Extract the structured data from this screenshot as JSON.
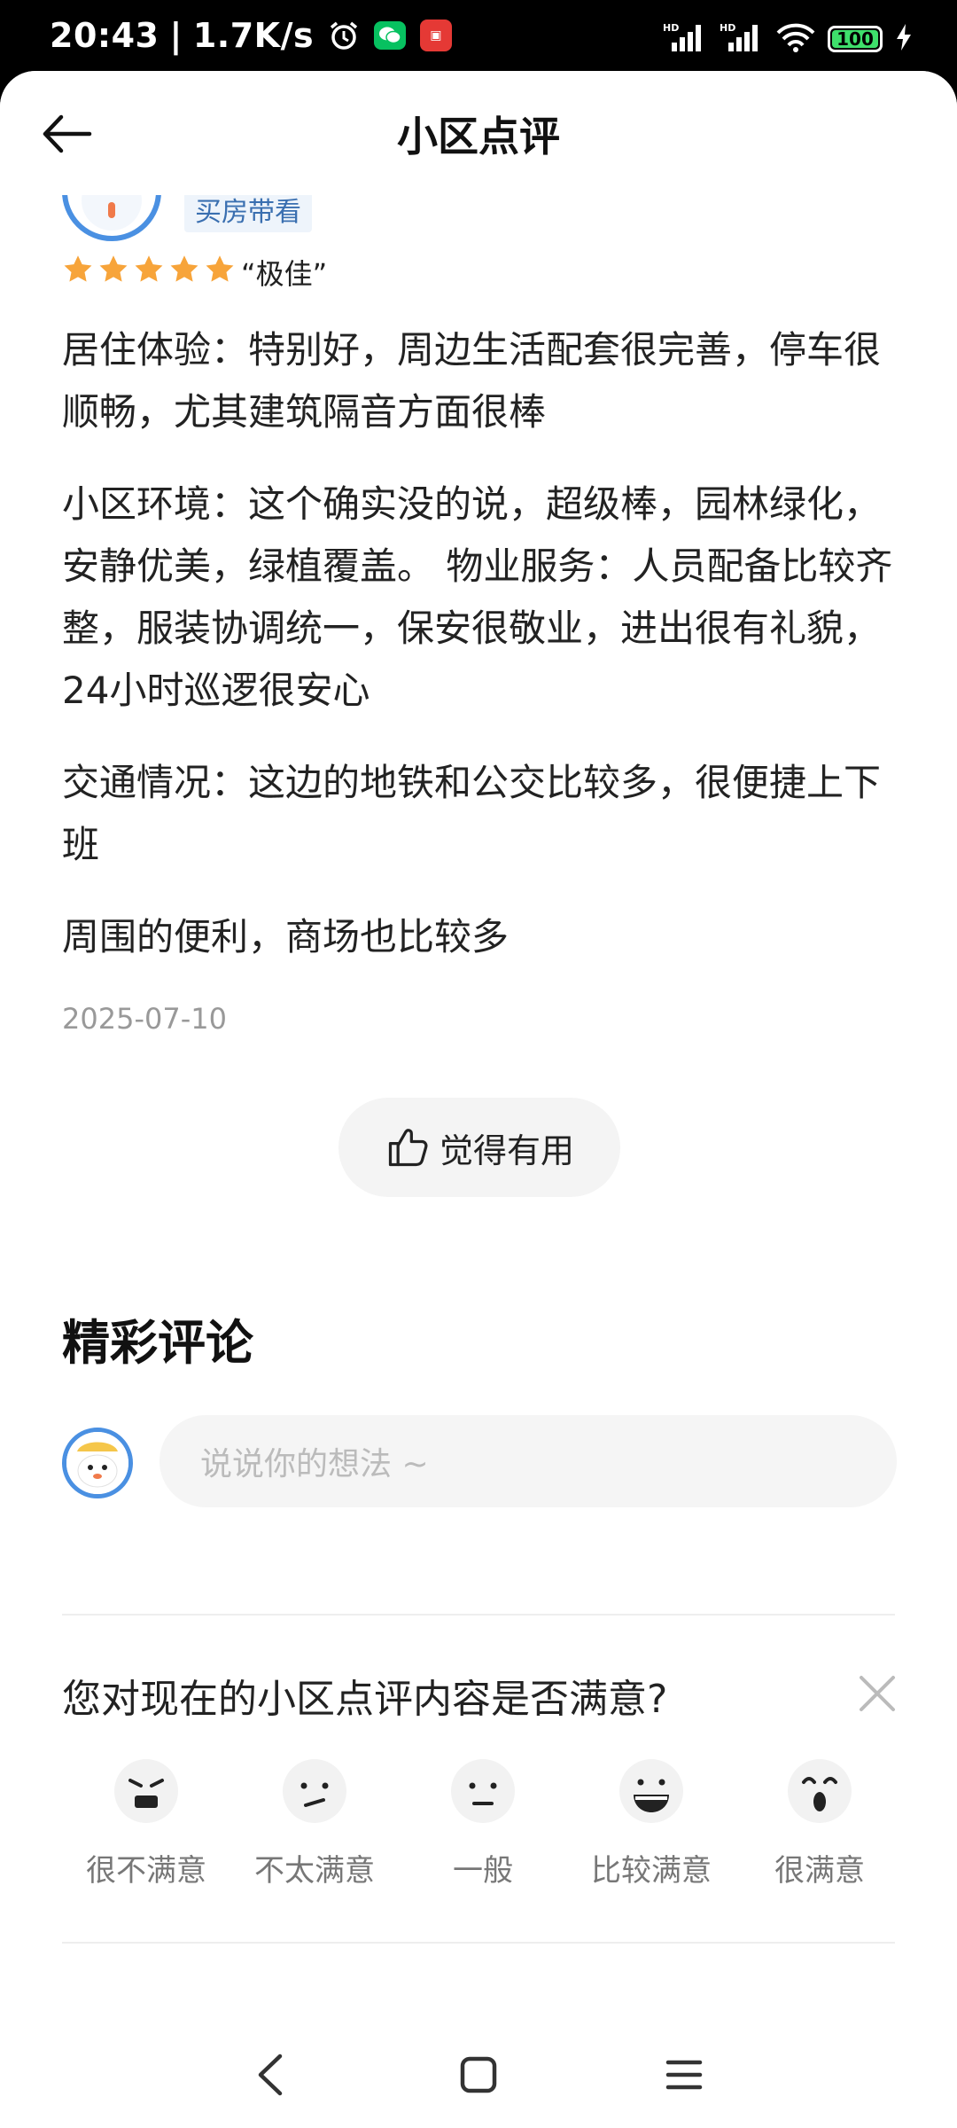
{
  "status_bar": {
    "time": "20:43",
    "separator": "|",
    "net_speed": "1.7K/s",
    "battery": "100",
    "signal_1_label": "HD",
    "signal_2_label": "HD"
  },
  "header": {
    "title": "小区点评"
  },
  "reviewer": {
    "tag": "买房带看",
    "rating_stars": 5,
    "rating_text": "“极佳”"
  },
  "review": {
    "paragraphs": [
      "居住体验：特别好，周边生活配套很完善，停车很顺畅，尤其建筑隔音方面很棒",
      "小区环境：这个确实没的说，超级棒，园林绿化，安静优美，绿植覆盖。 物业服务：人员配备比较齐整，服装协调统一，保安很敬业，进出很有礼貌，24小时巡逻很安心",
      "交通情况：这边的地铁和公交比较多，很便捷上下班",
      "周围的便利，商场也比较多"
    ],
    "date": "2025-07-10",
    "useful_label": "觉得有用"
  },
  "comments": {
    "section_title": "精彩评论",
    "input_placeholder": "说说你的想法 ~"
  },
  "survey": {
    "question": "您对现在的小区点评内容是否满意?",
    "options": [
      "很不满意",
      "不太满意",
      "一般",
      "比较满意",
      "很满意"
    ]
  },
  "colors": {
    "accent_blue": "#4a90e2",
    "star": "#f7a43a",
    "battery_green": "#3ee06b"
  }
}
